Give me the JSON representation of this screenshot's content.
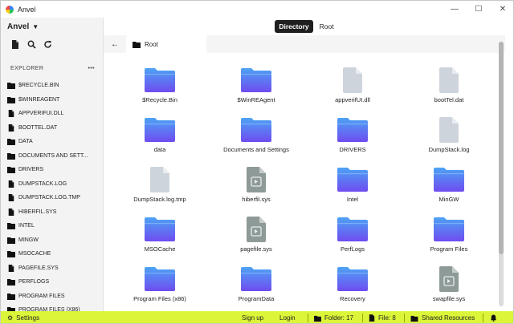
{
  "app": {
    "title": "Anvel",
    "brand": "Anvel"
  },
  "window_controls": {
    "minimize": "—",
    "maximize": "☐",
    "close": "✕"
  },
  "sidebar": {
    "explorer_label": "EXPLORER",
    "more": "•••",
    "items": [
      {
        "label": "$RECYCLE.BIN",
        "kind": "folder"
      },
      {
        "label": "$WINREAGENT",
        "kind": "folder"
      },
      {
        "label": "APPVERIFUI.DLL",
        "kind": "file"
      },
      {
        "label": "BOOTTEL.DAT",
        "kind": "file"
      },
      {
        "label": "DATA",
        "kind": "folder"
      },
      {
        "label": "DOCUMENTS AND SETT...",
        "kind": "folder"
      },
      {
        "label": "DRIVERS",
        "kind": "folder"
      },
      {
        "label": "DUMPSTACK.LOG",
        "kind": "file"
      },
      {
        "label": "DUMPSTACK.LOG.TMP",
        "kind": "file"
      },
      {
        "label": "HIBERFIL.SYS",
        "kind": "file"
      },
      {
        "label": "INTEL",
        "kind": "folder"
      },
      {
        "label": "MINGW",
        "kind": "folder"
      },
      {
        "label": "MSOCACHE",
        "kind": "folder"
      },
      {
        "label": "PAGEFILE.SYS",
        "kind": "file"
      },
      {
        "label": "PERFLOGS",
        "kind": "folder"
      },
      {
        "label": "PROGRAM FILES",
        "kind": "folder"
      },
      {
        "label": "PROGRAM FILES (X86)",
        "kind": "folder"
      }
    ]
  },
  "tabs": {
    "active": "Directory",
    "other": "Root"
  },
  "pathbar": {
    "crumb": "Root"
  },
  "grid": [
    {
      "label": "$Recycle.Bin",
      "kind": "folder"
    },
    {
      "label": "$WinREAgent",
      "kind": "folder"
    },
    {
      "label": "appverifUI.dll",
      "kind": "doc"
    },
    {
      "label": "bootTel.dat",
      "kind": "doc"
    },
    {
      "label": "data",
      "kind": "folder"
    },
    {
      "label": "Documents and Settings",
      "kind": "folder"
    },
    {
      "label": "DRIVERS",
      "kind": "folder"
    },
    {
      "label": "DumpStack.log",
      "kind": "doc"
    },
    {
      "label": "DumpStack.log.tmp",
      "kind": "doc"
    },
    {
      "label": "hiberfil.sys",
      "kind": "sys"
    },
    {
      "label": "Intel",
      "kind": "folder"
    },
    {
      "label": "MinGW",
      "kind": "folder"
    },
    {
      "label": "MSOCache",
      "kind": "folder"
    },
    {
      "label": "pagefile.sys",
      "kind": "sys"
    },
    {
      "label": "PerfLogs",
      "kind": "folder"
    },
    {
      "label": "Program Files",
      "kind": "folder"
    },
    {
      "label": "Program Files (x86)",
      "kind": "folder"
    },
    {
      "label": "ProgramData",
      "kind": "folder"
    },
    {
      "label": "Recovery",
      "kind": "folder"
    },
    {
      "label": "swapfile.sys",
      "kind": "sys"
    }
  ],
  "statusbar": {
    "settings": "Settings",
    "signup": "Sign up",
    "login": "Login",
    "folder": "Folder: 17",
    "file": "File: 8",
    "shared": "Shared Resources"
  },
  "colors": {
    "accent": "#dcf539",
    "folder_top": "#4da3f5",
    "folder_bottom": "#6f4cf0"
  }
}
